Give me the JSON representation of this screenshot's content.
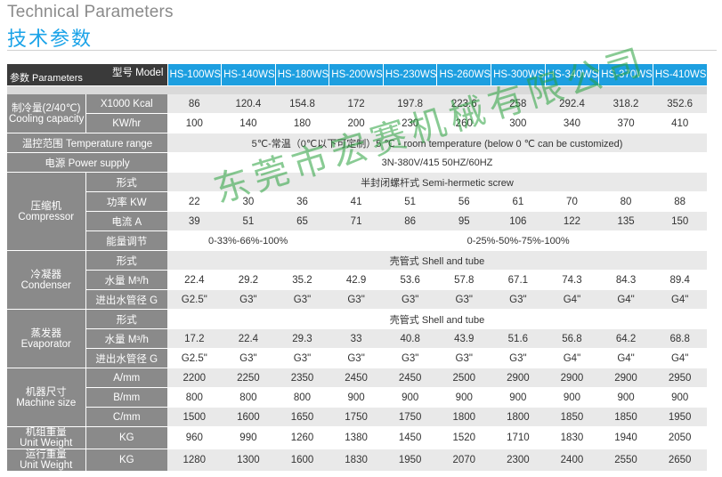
{
  "heading": {
    "en": "Technical Parameters",
    "cn": "技术参数"
  },
  "header": {
    "model_label": "型号 Model",
    "params_label": "参数 Parameters",
    "models": [
      "HS-100WS",
      "HS-140WS",
      "HS-180WS",
      "HS-200WS",
      "HS-230WS",
      "HS-260WS",
      "HS-300WS",
      "HS-340WS",
      "HS-370WS",
      "HS-410WS"
    ]
  },
  "cooling": {
    "label_cn": "制冷量(2/40℃)",
    "label_en": "Cooling capacity",
    "rows": [
      {
        "unit": "X1000 Kcal",
        "values": [
          "86",
          "120.4",
          "154.8",
          "172",
          "197.8",
          "223.6",
          "258",
          "292.4",
          "318.2",
          "352.6"
        ]
      },
      {
        "unit": "KW/hr",
        "values": [
          "100",
          "140",
          "180",
          "200",
          "230",
          "260",
          "300",
          "340",
          "370",
          "410"
        ]
      }
    ]
  },
  "temp_range": {
    "label": "温控范围 Temperature range",
    "value": "5℃-常温（0℃以下可定制）5 ℃ - room temperature (below 0 ℃ can be customized)"
  },
  "power": {
    "label": "电源 Power supply",
    "value": "3N-380V/415   50HZ/60HZ"
  },
  "compressor": {
    "label_cn": "压缩机",
    "label_en": "Compressor",
    "type_label": "形式",
    "type_value": "半封闭螺杆式 Semi-hermetic screw",
    "power_label": "功率 KW",
    "power_values": [
      "22",
      "30",
      "36",
      "41",
      "51",
      "56",
      "61",
      "70",
      "80",
      "88"
    ],
    "current_label": "电流 A",
    "current_values": [
      "39",
      "51",
      "65",
      "71",
      "86",
      "95",
      "106",
      "122",
      "135",
      "150"
    ],
    "regulation_label": "能量调节",
    "regulation_a": "0-33%-66%-100%",
    "regulation_b": "0-25%-50%-75%-100%"
  },
  "condenser": {
    "label_cn": "冷凝器",
    "label_en": "Condenser",
    "type_label": "形式",
    "type_value": "壳管式 Shell and tube",
    "flow_label": "水量 M³/h",
    "flow_values": [
      "22.4",
      "29.2",
      "35.2",
      "42.9",
      "53.6",
      "57.8",
      "67.1",
      "74.3",
      "84.3",
      "89.4"
    ],
    "pipe_label": "进出水管径 G",
    "pipe_values": [
      "G2.5\"",
      "G3\"",
      "G3\"",
      "G3\"",
      "G3\"",
      "G3\"",
      "G3\"",
      "G4\"",
      "G4\"",
      "G4\""
    ]
  },
  "evaporator": {
    "label_cn": "蒸发器",
    "label_en": "Evaporator",
    "type_label": "形式",
    "type_value": "壳管式 Shell and tube",
    "flow_label": "水量 M³/h",
    "flow_values": [
      "17.2",
      "22.4",
      "29.3",
      "33",
      "40.8",
      "43.9",
      "51.6",
      "56.8",
      "64.2",
      "68.8"
    ],
    "pipe_label": "进出水管径 G",
    "pipe_values": [
      "G2.5\"",
      "G3\"",
      "G3\"",
      "G3\"",
      "G3\"",
      "G3\"",
      "G3\"",
      "G4\"",
      "G4\"",
      "G4\""
    ]
  },
  "size": {
    "label_cn": "机器尺寸",
    "label_en": "Machine size",
    "rows": [
      {
        "unit": "A/mm",
        "values": [
          "2200",
          "2250",
          "2350",
          "2450",
          "2450",
          "2500",
          "2900",
          "2900",
          "2900",
          "2950"
        ]
      },
      {
        "unit": "B/mm",
        "values": [
          "800",
          "800",
          "800",
          "900",
          "900",
          "900",
          "900",
          "900",
          "900",
          "900"
        ]
      },
      {
        "unit": "C/mm",
        "values": [
          "1500",
          "1600",
          "1650",
          "1750",
          "1750",
          "1800",
          "1800",
          "1850",
          "1850",
          "1950"
        ]
      }
    ]
  },
  "unit_weight": {
    "label_cn": "机组重量",
    "label_en": "Unit Weight",
    "unit": "KG",
    "values": [
      "960",
      "990",
      "1260",
      "1380",
      "1450",
      "1520",
      "1710",
      "1830",
      "1940",
      "2050"
    ]
  },
  "running_weight": {
    "label_cn": "运行重量",
    "label_en": "Unit Weight",
    "unit": "KG",
    "values": [
      "1280",
      "1300",
      "1600",
      "1830",
      "1950",
      "2070",
      "2300",
      "2400",
      "2550",
      "2650"
    ]
  },
  "watermark": "东莞市宏赛机械有限公司"
}
